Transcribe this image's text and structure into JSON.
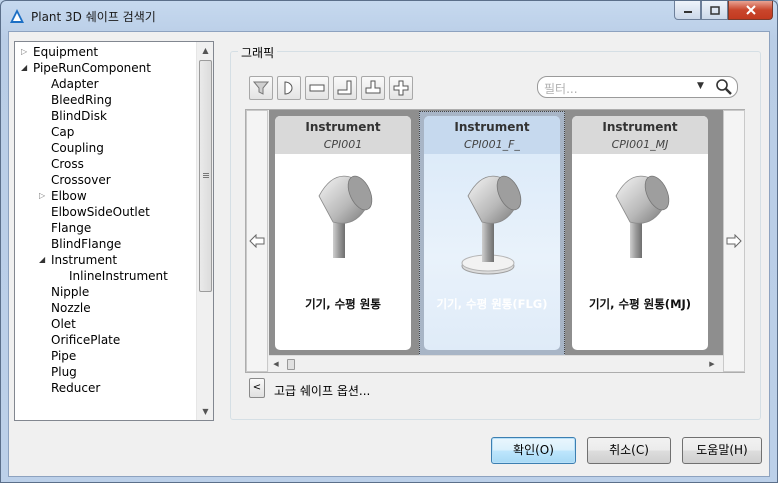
{
  "window": {
    "title": "Plant 3D 쉐이프 검색기",
    "controls": [
      "minimize",
      "maximize",
      "close"
    ]
  },
  "tree": {
    "items": [
      {
        "label": "Equipment",
        "level": 0,
        "arrow": "collapsed"
      },
      {
        "label": "PipeRunComponent",
        "level": 0,
        "arrow": "expanded"
      },
      {
        "label": "Adapter",
        "level": 1,
        "arrow": "none"
      },
      {
        "label": "BleedRing",
        "level": 1,
        "arrow": "none"
      },
      {
        "label": "BlindDisk",
        "level": 1,
        "arrow": "none"
      },
      {
        "label": "Cap",
        "level": 1,
        "arrow": "none"
      },
      {
        "label": "Coupling",
        "level": 1,
        "arrow": "none"
      },
      {
        "label": "Cross",
        "level": 1,
        "arrow": "none"
      },
      {
        "label": "Crossover",
        "level": 1,
        "arrow": "none"
      },
      {
        "label": "Elbow",
        "level": 1,
        "arrow": "collapsed"
      },
      {
        "label": "ElbowSideOutlet",
        "level": 1,
        "arrow": "none"
      },
      {
        "label": "Flange",
        "level": 1,
        "arrow": "none"
      },
      {
        "label": "BlindFlange",
        "level": 1,
        "arrow": "none"
      },
      {
        "label": "Instrument",
        "level": 1,
        "arrow": "expanded"
      },
      {
        "label": "InlineInstrument",
        "level": 2,
        "arrow": "none"
      },
      {
        "label": "Nipple",
        "level": 1,
        "arrow": "none"
      },
      {
        "label": "Nozzle",
        "level": 1,
        "arrow": "none"
      },
      {
        "label": "Olet",
        "level": 1,
        "arrow": "none"
      },
      {
        "label": "OrificePlate",
        "level": 1,
        "arrow": "none"
      },
      {
        "label": "Pipe",
        "level": 1,
        "arrow": "none"
      },
      {
        "label": "Plug",
        "level": 1,
        "arrow": "none"
      },
      {
        "label": "Reducer",
        "level": 1,
        "arrow": "none"
      }
    ]
  },
  "graphics": {
    "group_title": "그래픽",
    "toolbar": [
      "filter-icon",
      "half-round-icon",
      "line-icon",
      "elbow-icon",
      "tee-icon",
      "cross-icon"
    ],
    "filter_placeholder": "필터...",
    "cards": [
      {
        "category": "Instrument",
        "code": "CPI001",
        "description": "기기, 수평 원통",
        "selected": false,
        "has_base": false
      },
      {
        "category": "Instrument",
        "code": "CPI001_F_",
        "description": "기기, 수평 원통(FLG)",
        "selected": true,
        "has_base": true
      },
      {
        "category": "Instrument",
        "code": "CPI001_MJ",
        "description": "기기, 수평 원통(MJ)",
        "selected": false,
        "has_base": false
      }
    ],
    "advanced_button": "<",
    "advanced_label": "고급 쉐이프 옵션..."
  },
  "buttons": {
    "ok": "확인(O)",
    "cancel": "취소(C)",
    "help": "도움말(H)"
  },
  "colors": {
    "title_gradient": "#c6d9ef",
    "selected_card": "#d8e8f8",
    "close_button": "#c9462c"
  }
}
